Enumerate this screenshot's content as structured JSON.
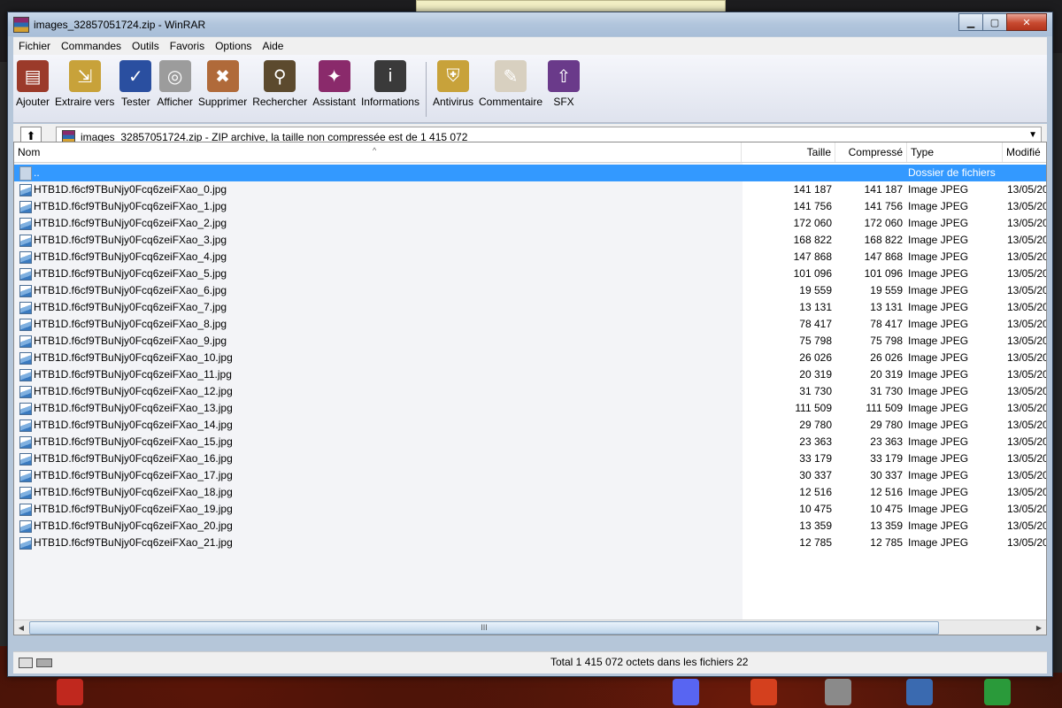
{
  "window": {
    "title": "images_32857051724.zip - WinRAR",
    "minimize": "▁",
    "maximize": "▢",
    "close": "✕"
  },
  "menu": [
    "Fichier",
    "Commandes",
    "Outils",
    "Favoris",
    "Options",
    "Aide"
  ],
  "toolbar": [
    {
      "label": "Ajouter",
      "icon": "archive-add-icon",
      "color": "#9b3a2a"
    },
    {
      "label": "Extraire vers",
      "icon": "extract-folder-icon",
      "color": "#c8a23a"
    },
    {
      "label": "Tester",
      "icon": "test-book-icon",
      "color": "#2a4fa0"
    },
    {
      "label": "Afficher",
      "icon": "view-glasses-icon",
      "color": "#9c9c9c"
    },
    {
      "label": "Supprimer",
      "icon": "delete-bin-icon",
      "color": "#b06a3a"
    },
    {
      "label": "Rechercher",
      "icon": "binoculars-icon",
      "color": "#5c4a2e"
    },
    {
      "label": "Assistant",
      "icon": "wizard-icon",
      "color": "#8a2a6b"
    },
    {
      "label": "Informations",
      "icon": "info-icon",
      "color": "#3a3a3a"
    },
    {
      "label": "Antivirus",
      "icon": "antivirus-icon",
      "color": "#c8a23a"
    },
    {
      "label": "Commentaire",
      "icon": "comment-pen-icon",
      "color": "#d8d0c0"
    },
    {
      "label": "SFX",
      "icon": "sfx-icon",
      "color": "#6a3a8a"
    }
  ],
  "address": {
    "up": "⬆",
    "text": "images_32857051724.zip - ZIP archive, la taille non compressée est de 1 415 072",
    "dropdown": "▼"
  },
  "columns": {
    "name": "Nom",
    "size": "Taille",
    "compressed": "Compressé",
    "type": "Type",
    "modified": "Modifié"
  },
  "parent": {
    "name": "..",
    "type": "Dossier de fichiers"
  },
  "files": [
    {
      "name": "HTB1D.f6cf9TBuNjy0Fcq6zeiFXao_0.jpg",
      "size": "141 187",
      "comp": "141 187",
      "type": "Image JPEG",
      "date": "13/05/20"
    },
    {
      "name": "HTB1D.f6cf9TBuNjy0Fcq6zeiFXao_1.jpg",
      "size": "141 756",
      "comp": "141 756",
      "type": "Image JPEG",
      "date": "13/05/20"
    },
    {
      "name": "HTB1D.f6cf9TBuNjy0Fcq6zeiFXao_2.jpg",
      "size": "172 060",
      "comp": "172 060",
      "type": "Image JPEG",
      "date": "13/05/20"
    },
    {
      "name": "HTB1D.f6cf9TBuNjy0Fcq6zeiFXao_3.jpg",
      "size": "168 822",
      "comp": "168 822",
      "type": "Image JPEG",
      "date": "13/05/20"
    },
    {
      "name": "HTB1D.f6cf9TBuNjy0Fcq6zeiFXao_4.jpg",
      "size": "147 868",
      "comp": "147 868",
      "type": "Image JPEG",
      "date": "13/05/20"
    },
    {
      "name": "HTB1D.f6cf9TBuNjy0Fcq6zeiFXao_5.jpg",
      "size": "101 096",
      "comp": "101 096",
      "type": "Image JPEG",
      "date": "13/05/20"
    },
    {
      "name": "HTB1D.f6cf9TBuNjy0Fcq6zeiFXao_6.jpg",
      "size": "19 559",
      "comp": "19 559",
      "type": "Image JPEG",
      "date": "13/05/20"
    },
    {
      "name": "HTB1D.f6cf9TBuNjy0Fcq6zeiFXao_7.jpg",
      "size": "13 131",
      "comp": "13 131",
      "type": "Image JPEG",
      "date": "13/05/20"
    },
    {
      "name": "HTB1D.f6cf9TBuNjy0Fcq6zeiFXao_8.jpg",
      "size": "78 417",
      "comp": "78 417",
      "type": "Image JPEG",
      "date": "13/05/20"
    },
    {
      "name": "HTB1D.f6cf9TBuNjy0Fcq6zeiFXao_9.jpg",
      "size": "75 798",
      "comp": "75 798",
      "type": "Image JPEG",
      "date": "13/05/20"
    },
    {
      "name": "HTB1D.f6cf9TBuNjy0Fcq6zeiFXao_10.jpg",
      "size": "26 026",
      "comp": "26 026",
      "type": "Image JPEG",
      "date": "13/05/20"
    },
    {
      "name": "HTB1D.f6cf9TBuNjy0Fcq6zeiFXao_11.jpg",
      "size": "20 319",
      "comp": "20 319",
      "type": "Image JPEG",
      "date": "13/05/20"
    },
    {
      "name": "HTB1D.f6cf9TBuNjy0Fcq6zeiFXao_12.jpg",
      "size": "31 730",
      "comp": "31 730",
      "type": "Image JPEG",
      "date": "13/05/20"
    },
    {
      "name": "HTB1D.f6cf9TBuNjy0Fcq6zeiFXao_13.jpg",
      "size": "111 509",
      "comp": "111 509",
      "type": "Image JPEG",
      "date": "13/05/20"
    },
    {
      "name": "HTB1D.f6cf9TBuNjy0Fcq6zeiFXao_14.jpg",
      "size": "29 780",
      "comp": "29 780",
      "type": "Image JPEG",
      "date": "13/05/20"
    },
    {
      "name": "HTB1D.f6cf9TBuNjy0Fcq6zeiFXao_15.jpg",
      "size": "23 363",
      "comp": "23 363",
      "type": "Image JPEG",
      "date": "13/05/20"
    },
    {
      "name": "HTB1D.f6cf9TBuNjy0Fcq6zeiFXao_16.jpg",
      "size": "33 179",
      "comp": "33 179",
      "type": "Image JPEG",
      "date": "13/05/20"
    },
    {
      "name": "HTB1D.f6cf9TBuNjy0Fcq6zeiFXao_17.jpg",
      "size": "30 337",
      "comp": "30 337",
      "type": "Image JPEG",
      "date": "13/05/20"
    },
    {
      "name": "HTB1D.f6cf9TBuNjy0Fcq6zeiFXao_18.jpg",
      "size": "12 516",
      "comp": "12 516",
      "type": "Image JPEG",
      "date": "13/05/20"
    },
    {
      "name": "HTB1D.f6cf9TBuNjy0Fcq6zeiFXao_19.jpg",
      "size": "10 475",
      "comp": "10 475",
      "type": "Image JPEG",
      "date": "13/05/20"
    },
    {
      "name": "HTB1D.f6cf9TBuNjy0Fcq6zeiFXao_20.jpg",
      "size": "13 359",
      "comp": "13 359",
      "type": "Image JPEG",
      "date": "13/05/20"
    },
    {
      "name": "HTB1D.f6cf9TBuNjy0Fcq6zeiFXao_21.jpg",
      "size": "12 785",
      "comp": "12 785",
      "type": "Image JPEG",
      "date": "13/05/20"
    }
  ],
  "scroll": {
    "thumb_label": "III",
    "left": "◀",
    "right": "▶"
  },
  "status": {
    "text": "Total 1 415 072 octets dans les fichiers 22"
  },
  "taskbar": [
    {
      "icon": "pdf-icon",
      "color": "#c0281e"
    },
    {
      "icon": "discord-icon",
      "color": "#5865f2"
    },
    {
      "icon": "app-icon",
      "color": "#d4401e"
    },
    {
      "icon": "audio-icon",
      "color": "#8a8a8a"
    },
    {
      "icon": "network-icon",
      "color": "#3a6ab0"
    },
    {
      "icon": "chrome-icon",
      "color": "#2a9a3a"
    }
  ]
}
